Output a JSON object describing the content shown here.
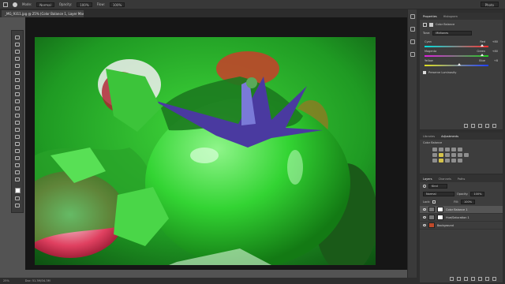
{
  "options_bar": {
    "mode_label": "Mode:",
    "mode_value": "Normal",
    "opacity_label": "Opacity:",
    "opacity_value": "100%",
    "flow_label": "Flow:",
    "flow_value": "100%",
    "workspace": "Photo"
  },
  "document_tab": {
    "label": "_MG_9311.jpg @ 25% (Color Balance 1, Layer Mask/8) *"
  },
  "status_bar": {
    "zoom": "25%",
    "doc_info": "Doc: 51.3M/34.3M"
  },
  "properties_panel": {
    "tab_properties": "Properties",
    "tab_histogram": "Histogram",
    "title": "Color Balance",
    "tone_label": "Tone:",
    "tone_value": "Midtones",
    "sliders": [
      {
        "left": "Cyan",
        "right": "Red",
        "value": "+80",
        "position": 0.9
      },
      {
        "left": "Magenta",
        "right": "Green",
        "value": "+80",
        "position": 0.9
      },
      {
        "left": "Yellow",
        "right": "Blue",
        "value": "+8",
        "position": 0.54
      }
    ],
    "preserve_luminosity": "Preserve Luminosity"
  },
  "adjustments_panel": {
    "tab_libraries": "Libraries",
    "tab_adjustments": "Adjustments",
    "subtitle": "Color Balance"
  },
  "layers_panel": {
    "tab_layers": "Layers",
    "tab_channels": "Channels",
    "tab_paths": "Paths",
    "kind_label": "Kind",
    "blend_mode": "Normal",
    "opacity_label": "Opacity:",
    "opacity_value": "100%",
    "lock_label": "Lock:",
    "fill_label": "Fill:",
    "fill_value": "100%",
    "layers": [
      {
        "name": "Color Balance 1",
        "selected": true
      },
      {
        "name": "Hue/Saturation 1",
        "selected": false
      },
      {
        "name": "Background",
        "selected": false
      }
    ]
  },
  "colors": {
    "accent_green": "#2fd12f",
    "panel_bg": "#3d3d3d",
    "canvas_bg": "#161616"
  }
}
